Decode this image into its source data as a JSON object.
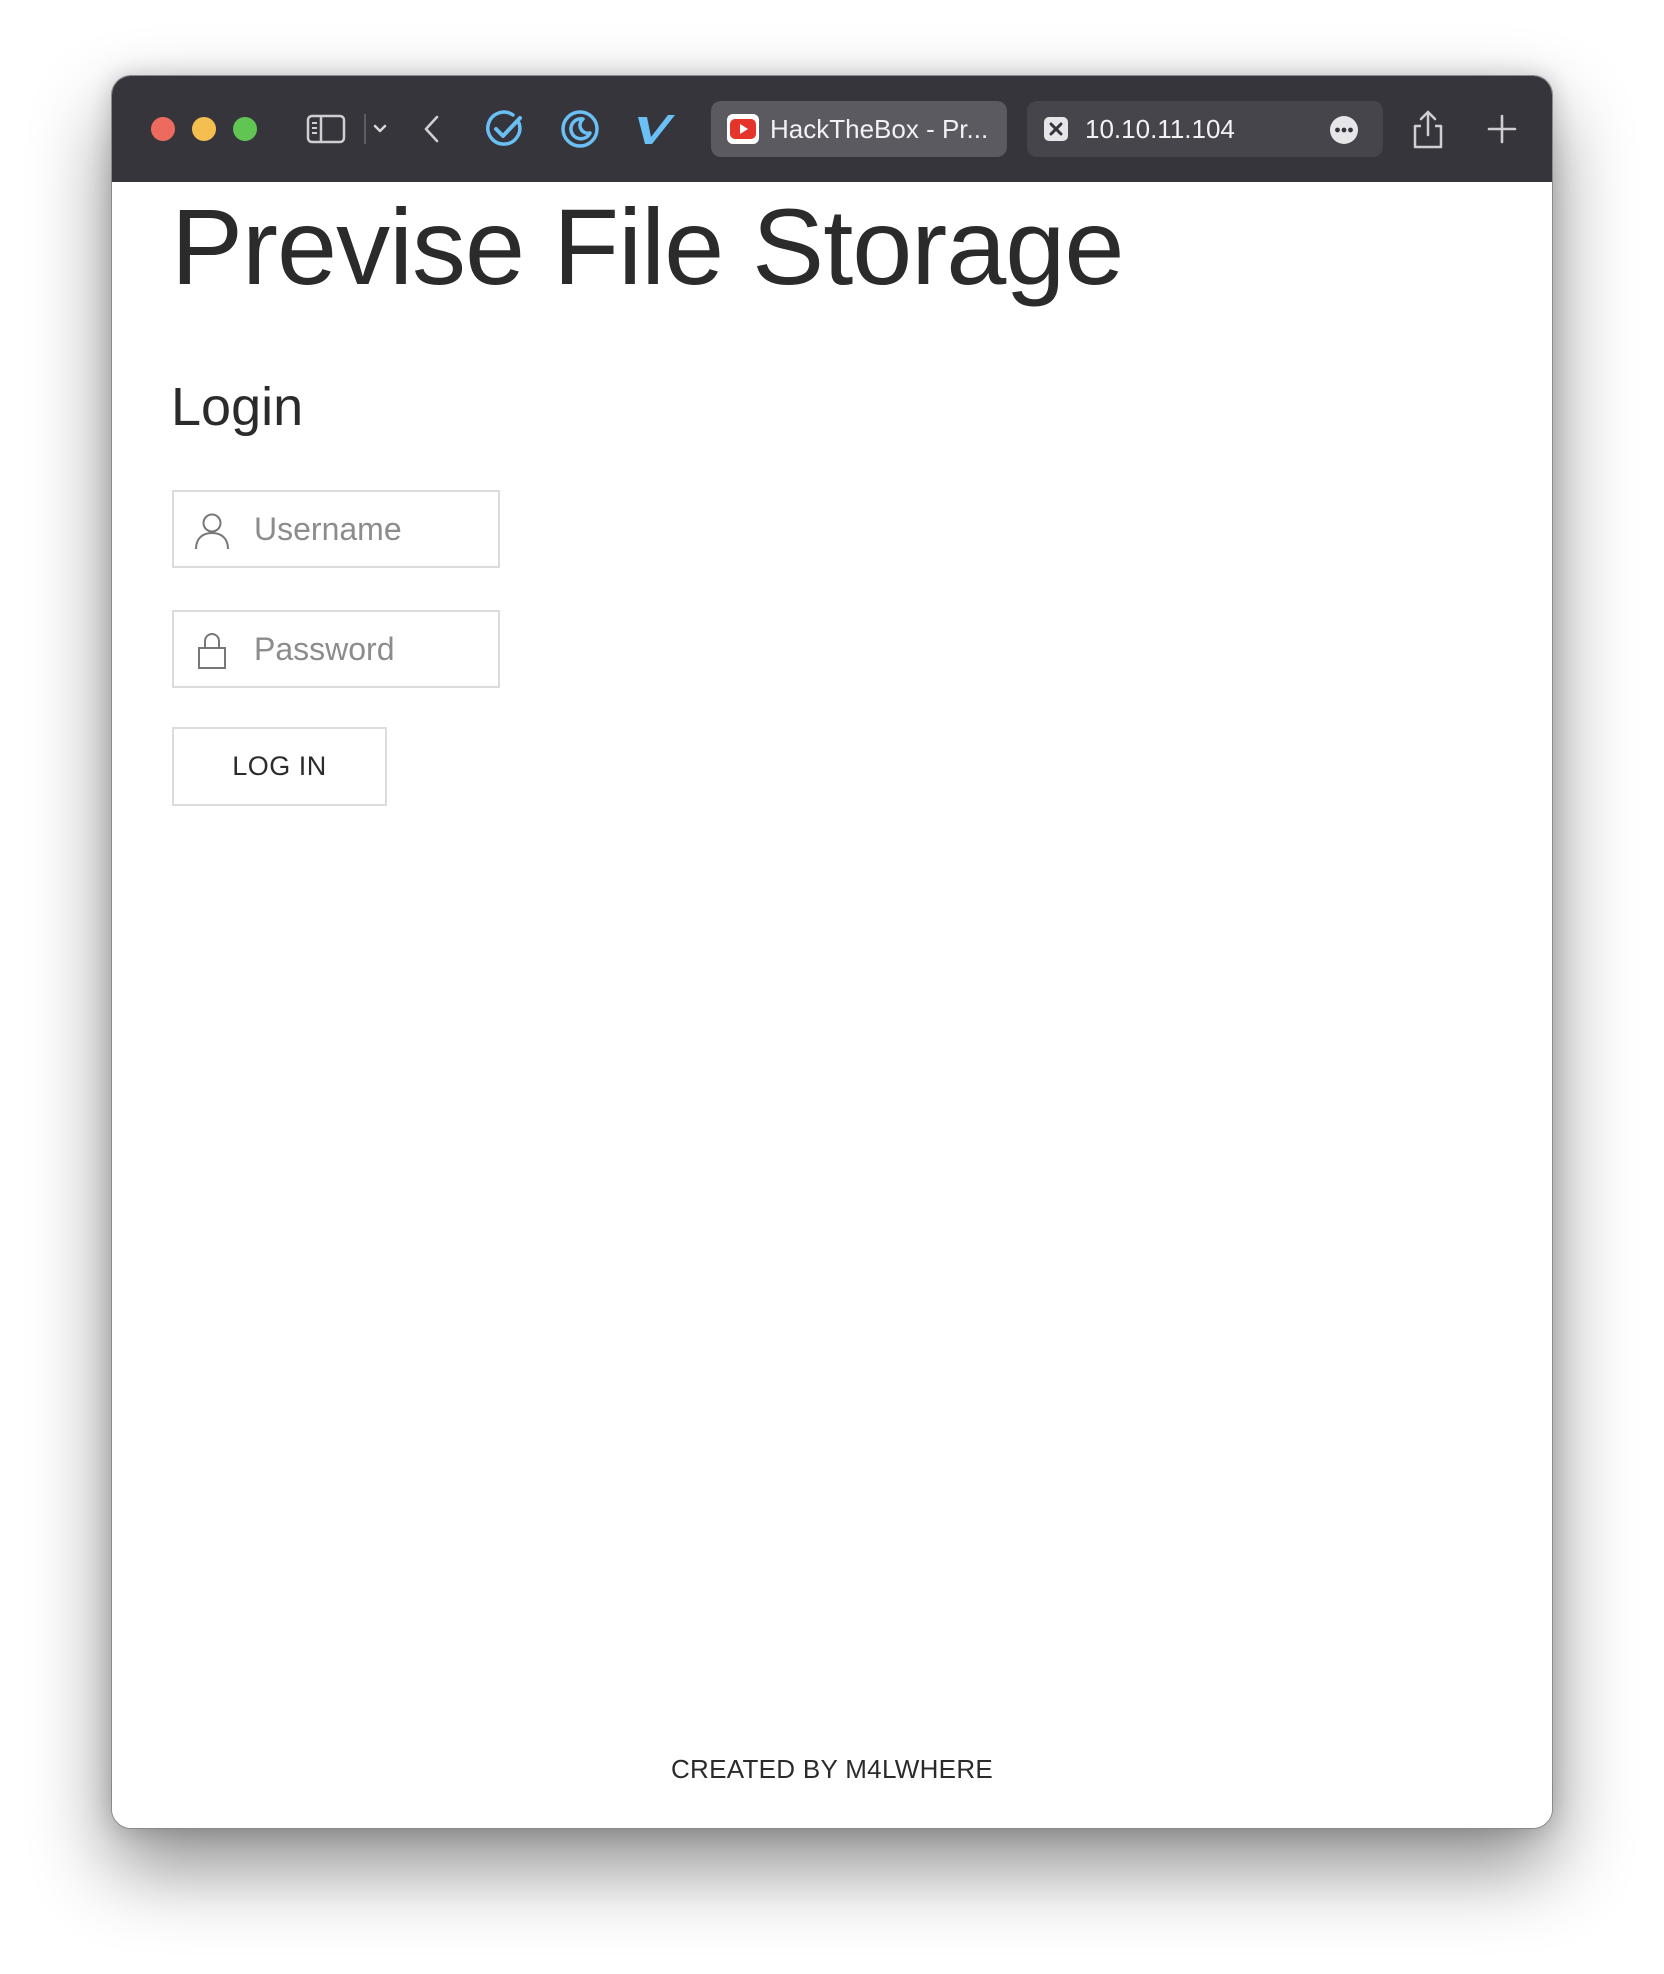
{
  "browser": {
    "tabs": [
      {
        "label": "HackTheBox - Pr...",
        "icon": "youtube-icon",
        "active": true
      },
      {
        "label": "10.10.11.104",
        "icon": "tab-close-icon",
        "active": false
      }
    ],
    "toolbar_icons": [
      "sidebar-icon",
      "chevron-down-icon",
      "back-icon",
      "check-circle-icon",
      "moon-icon",
      "v-icon",
      "more-icon",
      "share-icon",
      "plus-icon"
    ]
  },
  "page": {
    "title": "Previse File Storage",
    "login_heading": "Login",
    "username": {
      "placeholder": "Username",
      "value": ""
    },
    "password": {
      "placeholder": "Password",
      "value": ""
    },
    "login_button": "LOG IN",
    "footer": "CREATED BY M4LWHERE"
  },
  "colors": {
    "titlebar": "#36353b",
    "accent_icon": "#6ac0f5",
    "youtube_red": "#e5352b",
    "text": "#2b2b2b"
  }
}
